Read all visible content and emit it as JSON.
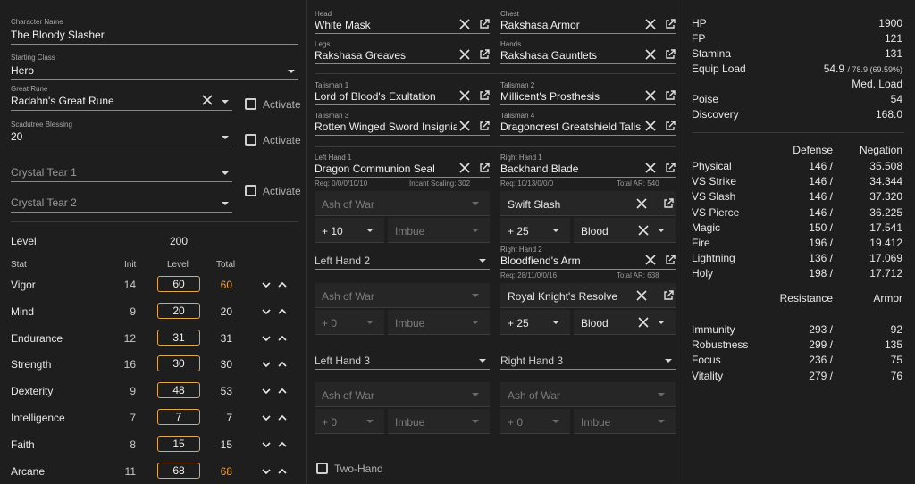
{
  "character": {
    "name_label": "Character Name",
    "name_value": "The Bloody Slasher",
    "class_label": "Starting Class",
    "class_value": "Hero",
    "rune_label": "Great Rune",
    "rune_value": "Radahn's Great Rune",
    "blessing_label": "Scadutree Blessing",
    "blessing_value": "20",
    "activate_label": "Activate",
    "tear1": "Crystal Tear 1",
    "tear2": "Crystal Tear 2"
  },
  "level": {
    "label": "Level",
    "value": "200"
  },
  "stats": {
    "headers": {
      "stat": "Stat",
      "init": "Init",
      "level": "Level",
      "total": "Total"
    },
    "rows": [
      {
        "name": "Vigor",
        "init": "14",
        "level": "60",
        "total": "60",
        "highlight": true
      },
      {
        "name": "Mind",
        "init": "9",
        "level": "20",
        "total": "20",
        "highlight": false
      },
      {
        "name": "Endurance",
        "init": "12",
        "level": "31",
        "total": "31",
        "highlight": false
      },
      {
        "name": "Strength",
        "init": "16",
        "level": "30",
        "total": "30",
        "highlight": false
      },
      {
        "name": "Dexterity",
        "init": "9",
        "level": "48",
        "total": "53",
        "highlight": false
      },
      {
        "name": "Intelligence",
        "init": "7",
        "level": "7",
        "total": "7",
        "highlight": false
      },
      {
        "name": "Faith",
        "init": "8",
        "level": "15",
        "total": "15",
        "highlight": false
      },
      {
        "name": "Arcane",
        "init": "11",
        "level": "68",
        "total": "68",
        "highlight": true
      }
    ]
  },
  "armor": {
    "head_label": "Head",
    "head_value": "White Mask",
    "chest_label": "Chest",
    "chest_value": "Rakshasa Armor",
    "legs_label": "Legs",
    "legs_value": "Rakshasa Greaves",
    "hands_label": "Hands",
    "hands_value": "Rakshasa Gauntlets"
  },
  "talismans": {
    "t1_label": "Talisman 1",
    "t1_value": "Lord of Blood's Exultation",
    "t2_label": "Talisman 2",
    "t2_value": "Millicent's Prosthesis",
    "t3_label": "Talisman 3",
    "t3_value": "Rotten Winged Sword Insignia",
    "t4_label": "Talisman 4",
    "t4_value": "Dragoncrest Greatshield Talisman"
  },
  "weapons": {
    "lh1_label": "Left Hand 1",
    "lh1_value": "Dragon Communion Seal",
    "lh1_req": "Req: 0/0/0/10/10",
    "lh1_extra": "Incant Scaling: 302",
    "lh1_ash": "Ash of War",
    "lh1_upgrade": "+ 10",
    "lh1_imbue": "Imbue",
    "rh1_label": "Right Hand 1",
    "rh1_value": "Backhand Blade",
    "rh1_req": "Req: 10/13/0/0/0",
    "rh1_extra": "Total AR: 540",
    "rh1_ash": "Swift Slash",
    "rh1_upgrade": "+ 25",
    "rh1_imbue": "Blood",
    "lh2_value": "Left Hand 2",
    "lh2_ash": "Ash of War",
    "lh2_upgrade": "+ 0",
    "lh2_imbue": "Imbue",
    "rh2_label": "Right Hand 2",
    "rh2_value": "Bloodfiend's Arm",
    "rh2_req": "Req: 28/11/0/0/16",
    "rh2_extra": "Total AR: 638",
    "rh2_ash": "Royal Knight's Resolve",
    "rh2_upgrade": "+ 25",
    "rh2_imbue": "Blood",
    "lh3_value": "Left Hand 3",
    "lh3_ash": "Ash of War",
    "lh3_upgrade": "+ 0",
    "lh3_imbue": "Imbue",
    "rh3_value": "Right Hand 3",
    "rh3_ash": "Ash of War",
    "rh3_upgrade": "+ 0",
    "rh3_imbue": "Imbue",
    "two_hand": "Two-Hand"
  },
  "summary": {
    "rows": [
      {
        "label": "HP",
        "value": "1900"
      },
      {
        "label": "FP",
        "value": "121"
      },
      {
        "label": "Stamina",
        "value": "131"
      }
    ],
    "equip_label": "Equip Load",
    "equip_main": "54.9",
    "equip_sub": "/ 78.9 (69.59%)",
    "equip_class": "Med. Load",
    "poise_label": "Poise",
    "poise_value": "54",
    "discovery_label": "Discovery",
    "discovery_value": "168.0"
  },
  "defense": {
    "h_defense": "Defense",
    "h_negation": "Negation",
    "rows": [
      {
        "label": "Physical",
        "def": "146 /",
        "neg": "35.508"
      },
      {
        "label": "VS Strike",
        "def": "146 /",
        "neg": "34.344"
      },
      {
        "label": "VS Slash",
        "def": "146 /",
        "neg": "37.320"
      },
      {
        "label": "VS Pierce",
        "def": "146 /",
        "neg": "36.225"
      },
      {
        "label": "Magic",
        "def": "150 /",
        "neg": "17.541"
      },
      {
        "label": "Fire",
        "def": "196 /",
        "neg": "19.412"
      },
      {
        "label": "Lightning",
        "def": "136 /",
        "neg": "17.069"
      },
      {
        "label": "Holy",
        "def": "198 /",
        "neg": "17.712"
      }
    ]
  },
  "resistance": {
    "h_resistance": "Resistance",
    "h_armor": "Armor",
    "rows": [
      {
        "label": "Immunity",
        "res": "293 /",
        "arm": "92"
      },
      {
        "label": "Robustness",
        "res": "299 /",
        "arm": "135"
      },
      {
        "label": "Focus",
        "res": "236 /",
        "arm": "75"
      },
      {
        "label": "Vitality",
        "res": "279 /",
        "arm": "76"
      }
    ]
  },
  "colors": {
    "background": "#1e1e1e",
    "accent": "#e8a435",
    "box_border": "#e0a94a"
  }
}
